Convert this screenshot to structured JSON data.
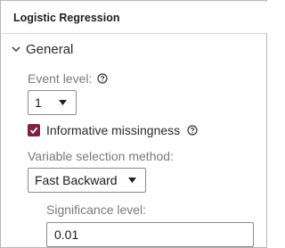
{
  "panel": {
    "title": "Logistic Regression"
  },
  "section": {
    "label": "General",
    "expanded": true
  },
  "event_level": {
    "label": "Event level:",
    "selected": "1"
  },
  "informative_missingness": {
    "label": "Informative missingness",
    "checked": true
  },
  "variable_selection": {
    "label": "Variable selection method:",
    "selected": "Fast Backward"
  },
  "significance_level": {
    "label": "Significance level:",
    "value": "0.01"
  },
  "colors": {
    "checkbox_accent": "#7e1f46",
    "label_muted": "#7a7a7a"
  },
  "icons": {
    "section_toggle": "chevron-down-icon",
    "help": "help-circle-icon",
    "dropdown": "caret-down-icon",
    "checkbox": "checkmark-icon"
  }
}
